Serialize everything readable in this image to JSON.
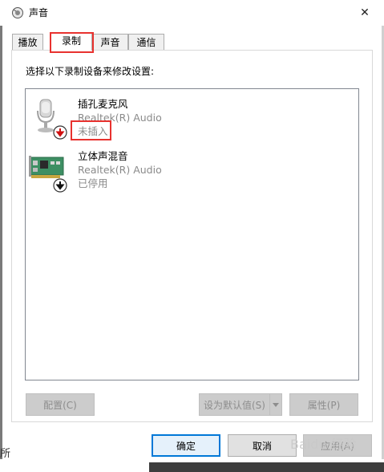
{
  "window": {
    "title": "声音",
    "close_glyph": "✕"
  },
  "tabs": [
    {
      "label": "播放"
    },
    {
      "label": "录制",
      "selected": true
    },
    {
      "label": "声音"
    },
    {
      "label": "通信"
    }
  ],
  "instruction": "选择以下录制设备来修改设置:",
  "devices": [
    {
      "name": "插孔麦克风",
      "driver": "Realtek(R) Audio",
      "status": "未插入",
      "icon": "microphone-icon",
      "badge": "unplugged-arrow-icon"
    },
    {
      "name": "立体声混音",
      "driver": "Realtek(R) Audio",
      "status": "已停用",
      "icon": "sound-card-icon",
      "badge": "disabled-arrow-icon"
    }
  ],
  "buttons": {
    "configure": "配置(C)",
    "set_default": "设为默认值(S)",
    "properties": "属性(P)",
    "ok": "确定",
    "cancel": "取消",
    "apply": "应用(A)"
  },
  "edge_text": "所",
  "watermark": "Baidu 经验",
  "colors": {
    "highlight": "#e8322f",
    "focus": "#0078d7"
  }
}
